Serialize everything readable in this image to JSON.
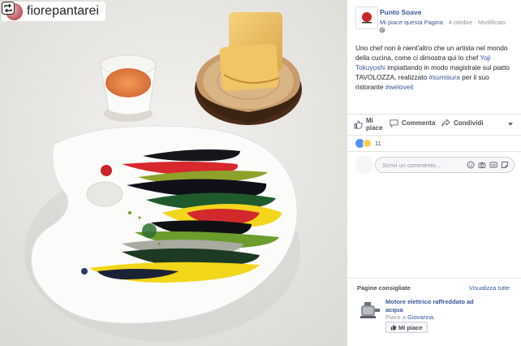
{
  "instagram_repost": {
    "username": "fiorepantarei"
  },
  "post": {
    "page_name": "Punto Soave",
    "like_page_link": "Mi piace questa Pagina",
    "meta_separator": " · ",
    "date": "4 ottobre",
    "edited": "Modificato",
    "text_part1": "Uno chef non è nient'altro che un artista nel mondo della cucina, come ci dimostra qui lo chef ",
    "chef_link": "Yoji Tokuyoshi",
    "text_part2": " impiattando in modo magistrale sul piatto TAVOLOZZA, realizzato ",
    "hashtag1": "#sumisura",
    "text_part3": " per il suo ristorante ",
    "hashtag2": "#weloveit"
  },
  "actions": {
    "like_line1": "Mi",
    "like_line2": "piace",
    "comment": "Commenta",
    "share": "Condividi"
  },
  "reactions": {
    "count": "11"
  },
  "comment_box": {
    "placeholder": "Scrivi un commento..."
  },
  "suggested": {
    "title": "Pagine consigliate",
    "see_all": "Visualizza tutte",
    "item_name": "Motore elettrico raffreddato ad acqua",
    "liked_by_prefix": "Piace a ",
    "liked_by_name": "Giovanna.",
    "like_button": "Mi piace"
  },
  "colors": {
    "facebook_link": "#365899",
    "facebook_text": "#1d2129",
    "muted": "#90949c",
    "like_blue": "#5890ff"
  }
}
